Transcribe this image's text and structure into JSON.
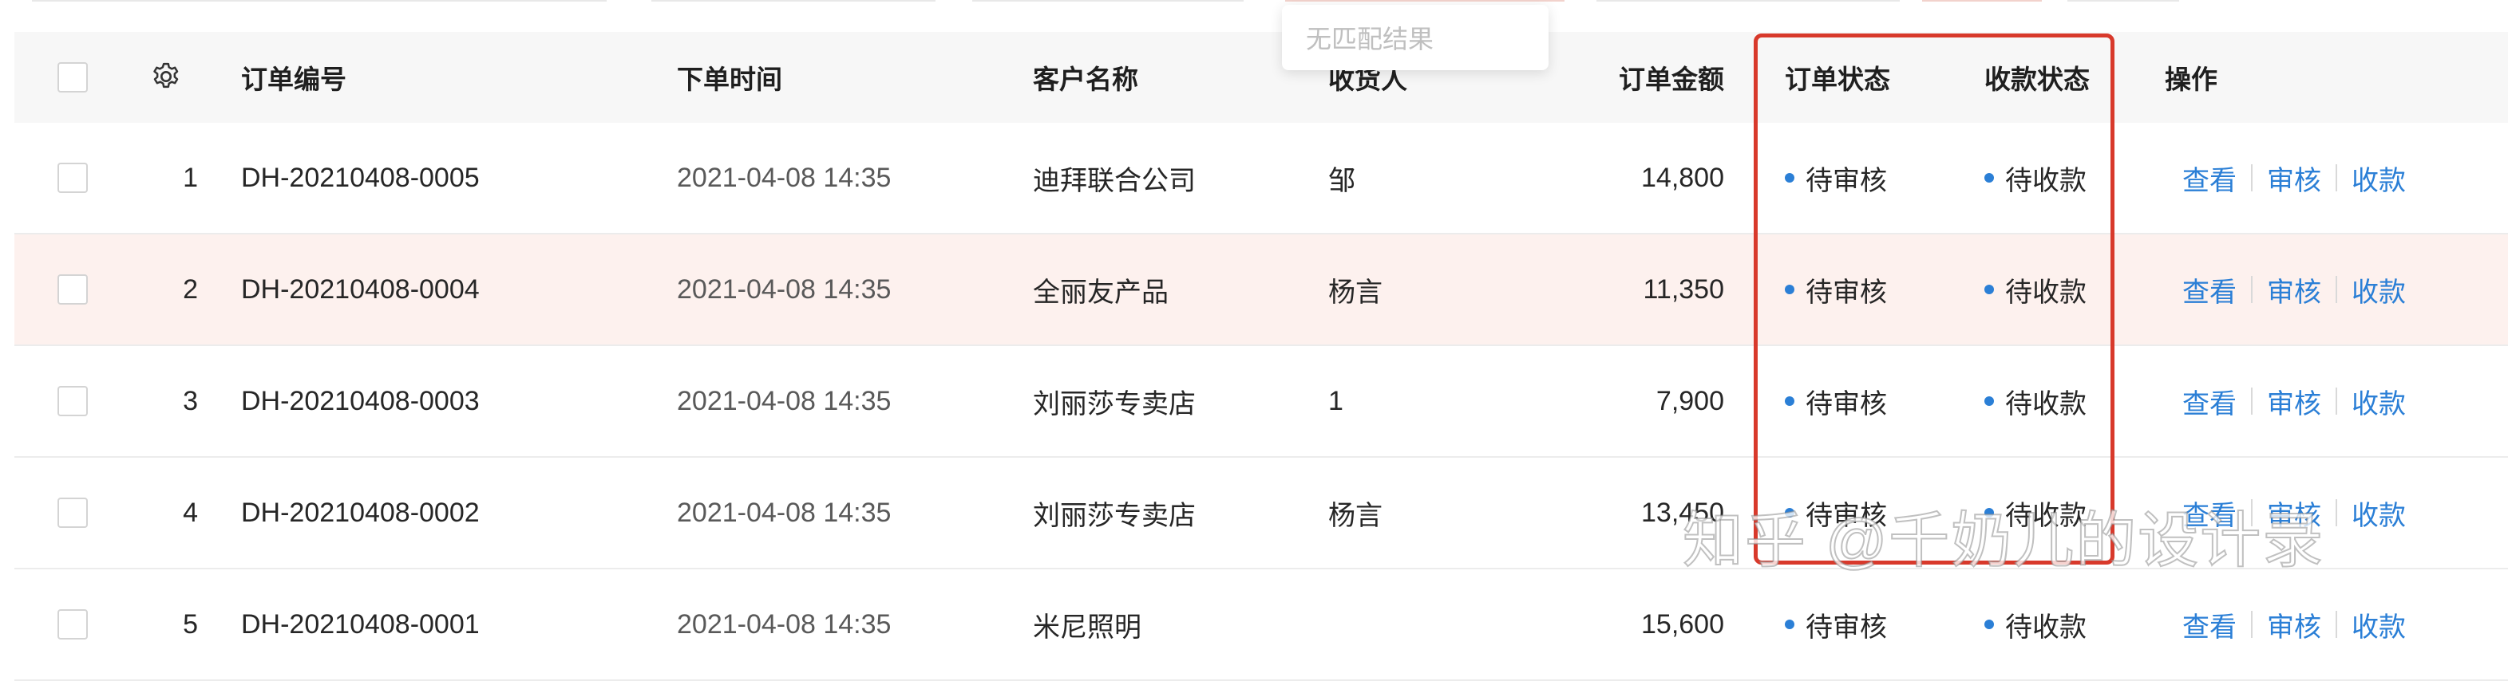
{
  "search_dropdown": {
    "empty_text": "无匹配结果"
  },
  "table": {
    "headers": {
      "order_no": "订单编号",
      "order_time": "下单时间",
      "customer": "客户名称",
      "receiver": "收货人",
      "amount": "订单金额",
      "order_status": "订单状态",
      "payment_status": "收款状态",
      "actions": "操作"
    },
    "rows": [
      {
        "index": "1",
        "order_no": "DH-20210408-0005",
        "order_time": "2021-04-08 14:35",
        "customer": "迪拜联合公司",
        "receiver": "邹",
        "amount": "14,800",
        "order_status": "待审核",
        "payment_status": "待收款",
        "action_view": "查看",
        "action_review": "审核",
        "action_collect": "收款"
      },
      {
        "index": "2",
        "order_no": "DH-20210408-0004",
        "order_time": "2021-04-08 14:35",
        "customer": "全丽友产品",
        "receiver": "杨言",
        "amount": "11,350",
        "order_status": "待审核",
        "payment_status": "待收款",
        "action_view": "查看",
        "action_review": "审核",
        "action_collect": "收款"
      },
      {
        "index": "3",
        "order_no": "DH-20210408-0003",
        "order_time": "2021-04-08 14:35",
        "customer": "刘丽莎专卖店",
        "receiver": "1",
        "amount": "7,900",
        "order_status": "待审核",
        "payment_status": "待收款",
        "action_view": "查看",
        "action_review": "审核",
        "action_collect": "收款"
      },
      {
        "index": "4",
        "order_no": "DH-20210408-0002",
        "order_time": "2021-04-08 14:35",
        "customer": "刘丽莎专卖店",
        "receiver": "杨言",
        "amount": "13,450",
        "order_status": "待审核",
        "payment_status": "待收款",
        "action_view": "查看",
        "action_review": "审核",
        "action_collect": "收款"
      },
      {
        "index": "5",
        "order_no": "DH-20210408-0001",
        "order_time": "2021-04-08 14:35",
        "customer": "米尼照明",
        "receiver": "",
        "amount": "15,600",
        "order_status": "待审核",
        "payment_status": "待收款",
        "action_view": "查看",
        "action_review": "审核",
        "action_collect": "收款"
      }
    ]
  },
  "icons": {
    "settings": "gear-icon",
    "status_dot": "status-dot-icon"
  },
  "colors": {
    "link": "#2b7fd6",
    "status_dot": "#2b7fd6",
    "highlight_box": "#d8392b",
    "highlight_row": "#fdf1ee"
  },
  "watermark": "知乎 @千奶儿的设计录"
}
